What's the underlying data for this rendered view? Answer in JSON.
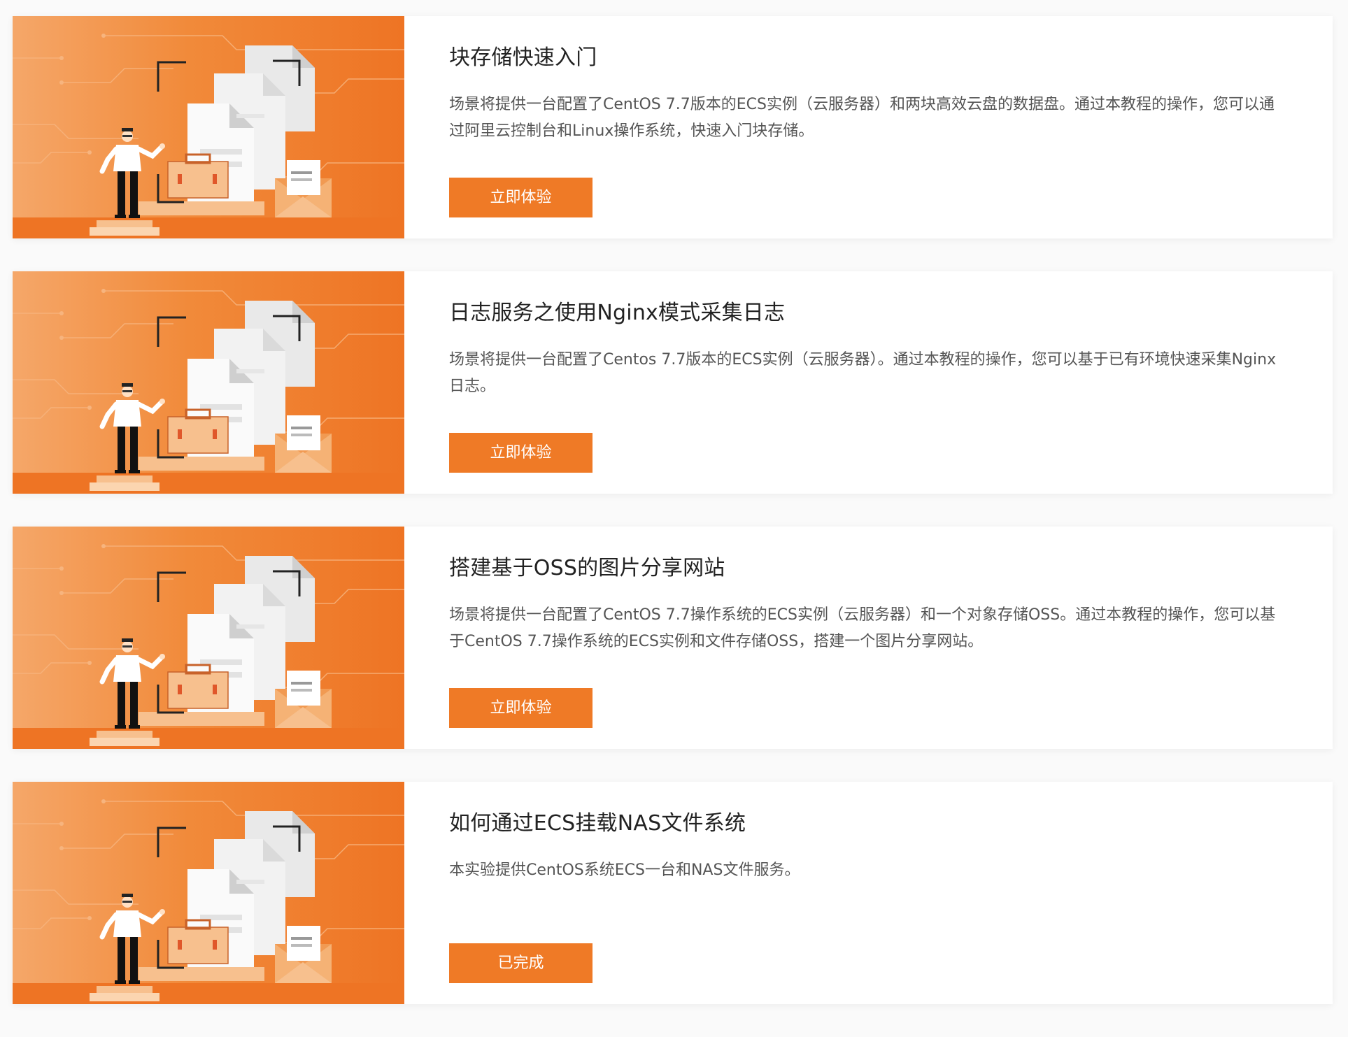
{
  "courses": [
    {
      "title": "块存储快速入门",
      "description": "场景将提供一台配置了CentOS 7.7版本的ECS实例（云服务器）和两块高效云盘的数据盘。通过本教程的操作，您可以通过阿里云控制台和Linux操作系统，快速入门块存储。",
      "button_label": "立即体验"
    },
    {
      "title": "日志服务之使用Nginx模式采集日志",
      "description": "场景将提供一台配置了Centos 7.7版本的ECS实例（云服务器）。通过本教程的操作，您可以基于已有环境快速采集Nginx日志。",
      "button_label": "立即体验"
    },
    {
      "title": "搭建基于OSS的图片分享网站",
      "description": "场景将提供一台配置了CentOS 7.7操作系统的ECS实例（云服务器）和一个对象存储OSS。通过本教程的操作，您可以基于CentOS 7.7操作系统的ECS实例和文件存储OSS，搭建一个图片分享网站。",
      "button_label": "立即体验"
    },
    {
      "title": "如何通过ECS挂载NAS文件系统",
      "description": "本实验提供CentOS系统ECS一台和NAS文件服务。",
      "button_label": "已完成"
    }
  ],
  "colors": {
    "accent": "#ef7a26",
    "banner_light": "#f5a769",
    "banner_dark": "#ee7424"
  },
  "banner_illustration": "person-with-documents-illustration"
}
